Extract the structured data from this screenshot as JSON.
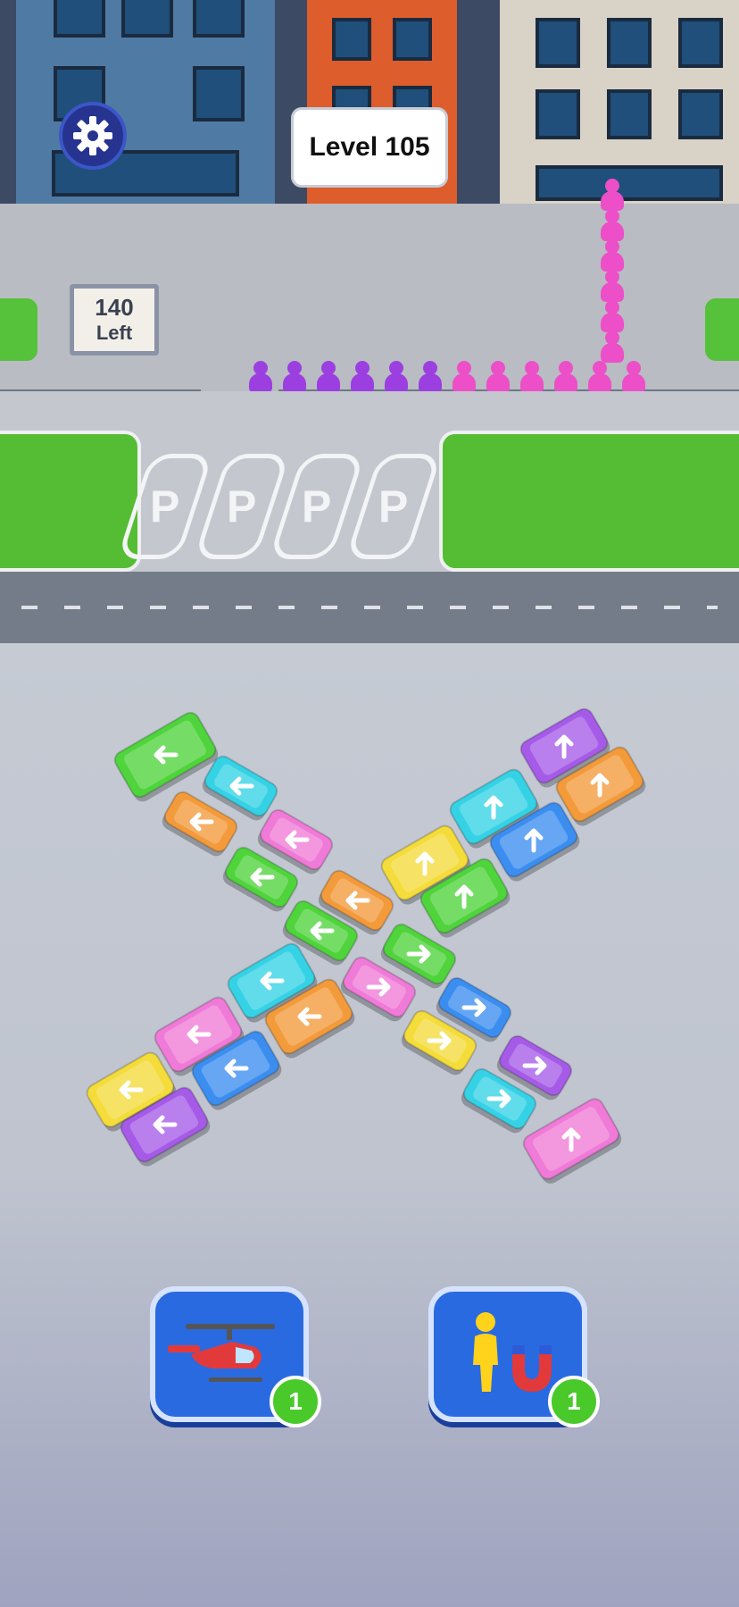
{
  "hud": {
    "level_label": "Level 105",
    "passengers_left_count": "140",
    "passengers_left_label": "Left"
  },
  "settings": {
    "icon": "gear-icon"
  },
  "parking": {
    "spots": [
      "P",
      "P",
      "P",
      "P"
    ]
  },
  "queue": {
    "passenger_colors": [
      "#9b3fe0",
      "#9b3fe0",
      "#9b3fe0",
      "#9b3fe0",
      "#9b3fe0",
      "#9b3fe0",
      "#ec4fc8",
      "#ec4fc8",
      "#ec4fc8",
      "#ec4fc8",
      "#ec4fc8",
      "#ec4fc8",
      "#ec4fc8",
      "#ec4fc8",
      "#ec4fc8",
      "#ec4fc8",
      "#ec4fc8",
      "#ec4fc8"
    ]
  },
  "vehicles": [
    {
      "kind": "bus",
      "color": "#4fd43c",
      "dir": "left"
    },
    {
      "kind": "car",
      "color": "#35d2e6",
      "dir": "left"
    },
    {
      "kind": "car",
      "color": "#f39a3a",
      "dir": "left"
    },
    {
      "kind": "car",
      "color": "#f07ad7",
      "dir": "left"
    },
    {
      "kind": "car",
      "color": "#4fd43c",
      "dir": "left"
    },
    {
      "kind": "car",
      "color": "#f39a3a",
      "dir": "left"
    },
    {
      "kind": "car",
      "color": "#4fd43c",
      "dir": "left"
    },
    {
      "kind": "car",
      "color": "#4fd43c",
      "dir": "right"
    },
    {
      "kind": "car",
      "color": "#f07ad7",
      "dir": "right"
    },
    {
      "kind": "car",
      "color": "#3b8ef0",
      "dir": "right"
    },
    {
      "kind": "car",
      "color": "#f4dc3a",
      "dir": "right"
    },
    {
      "kind": "car",
      "color": "#a65be8",
      "dir": "right"
    },
    {
      "kind": "car",
      "color": "#35d2e6",
      "dir": "right"
    },
    {
      "kind": "bus",
      "color": "#a65be8",
      "dir": "up"
    },
    {
      "kind": "bus",
      "color": "#f39a3a",
      "dir": "up"
    },
    {
      "kind": "bus",
      "color": "#35d2e6",
      "dir": "up"
    },
    {
      "kind": "bus",
      "color": "#3b8ef0",
      "dir": "up"
    },
    {
      "kind": "bus",
      "color": "#f4dc3a",
      "dir": "up"
    },
    {
      "kind": "bus",
      "color": "#4fd43c",
      "dir": "up"
    },
    {
      "kind": "bus",
      "color": "#35d2e6",
      "dir": "left"
    },
    {
      "kind": "bus",
      "color": "#f39a3a",
      "dir": "left"
    },
    {
      "kind": "bus",
      "color": "#f07ad7",
      "dir": "left"
    },
    {
      "kind": "bus",
      "color": "#3b8ef0",
      "dir": "left"
    },
    {
      "kind": "bus",
      "color": "#f4dc3a",
      "dir": "left"
    },
    {
      "kind": "bus",
      "color": "#a65be8",
      "dir": "left"
    },
    {
      "kind": "bus",
      "color": "#f07ad7",
      "dir": "up"
    }
  ],
  "boosters": [
    {
      "name": "helicopter",
      "icon": "helicopter-icon",
      "count": "1"
    },
    {
      "name": "magnet",
      "icon": "magnet-icon",
      "count": "1"
    }
  ]
}
